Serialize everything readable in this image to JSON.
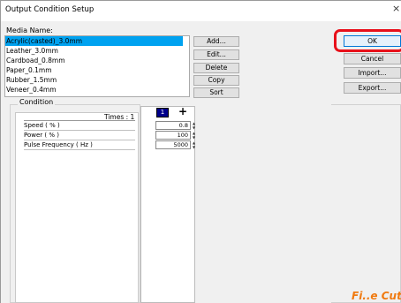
{
  "window": {
    "title": "Output Condition Setup"
  },
  "media": {
    "label": "Media Name:",
    "items": [
      "Acrylic(casted)_3.0mm",
      "Leather_3.0mm",
      "Cardboad_0.8mm",
      "Paper_0.1mm",
      "Rubber_1.5mm",
      "Veneer_0.4mm"
    ],
    "selected_index": 0
  },
  "list_buttons": {
    "add": "Add...",
    "edit": "Edit...",
    "delete": "Delete",
    "copy": "Copy",
    "sort": "Sort"
  },
  "side_buttons": {
    "ok": "OK",
    "cancel": "Cancel",
    "import": "Import...",
    "export": "Export..."
  },
  "condition": {
    "label": "Condition",
    "times_label": "Times : 1",
    "rows": [
      "Speed ( % )",
      "Power ( % )",
      "Pulse Frequency ( Hz )"
    ],
    "column_number": "1",
    "add_symbol": "+",
    "values": [
      "0.8",
      "100",
      "5000"
    ]
  },
  "logo": {
    "text": "Fi..e Cut S"
  },
  "colors": {
    "selection": "#00a2f0",
    "highlight_ring": "#e8101a",
    "logo": "#f07a10"
  }
}
